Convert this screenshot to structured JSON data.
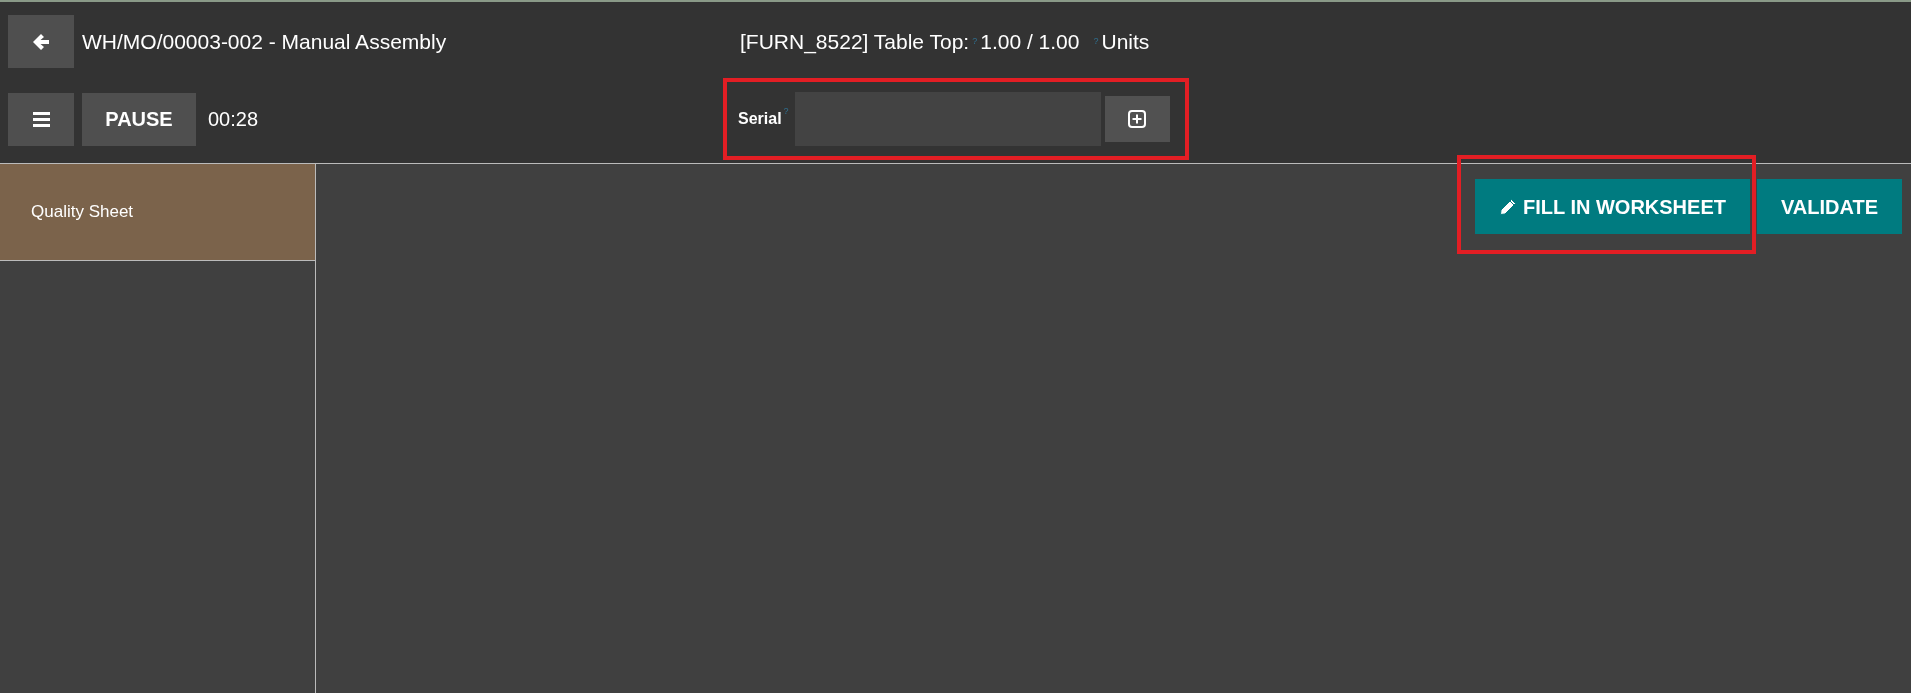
{
  "header": {
    "title": "WH/MO/00003-002 - Manual Assembly",
    "product": {
      "label": "[FURN_8522] Table Top:",
      "label_help": "?",
      "quantity": "1.00 / 1.00",
      "quantity_help": "?",
      "uom": "Units"
    }
  },
  "toolbar": {
    "pause_button": "PAUSE",
    "timer": "00:28"
  },
  "serial": {
    "label": "Serial",
    "help": "?",
    "highlighted": true
  },
  "sidebar": {
    "items": [
      {
        "label": "Quality Sheet",
        "selected": true
      }
    ]
  },
  "actions": [
    {
      "label": "FILL IN WORKSHEET",
      "kind": "edit",
      "highlighted": true
    },
    {
      "label": "VALIDATE",
      "kind": "plain",
      "highlighted": false
    }
  ]
}
